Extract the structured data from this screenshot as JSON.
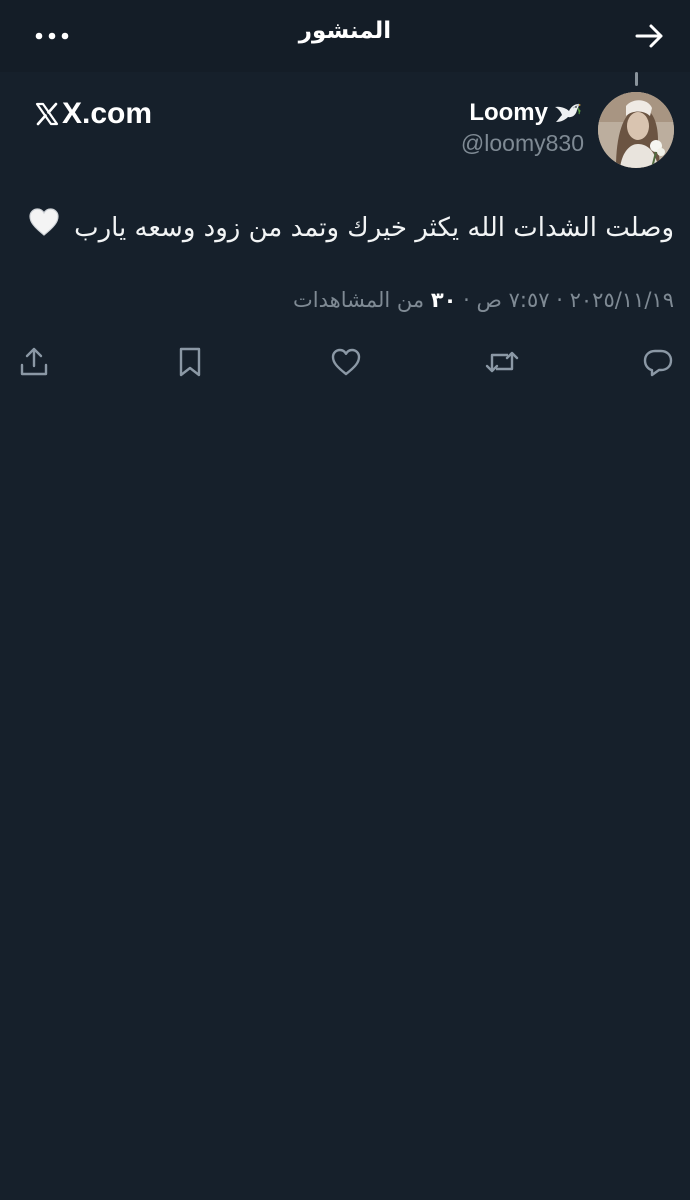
{
  "header": {
    "title": "المنشور",
    "back_icon": "arrow-right-icon",
    "more_icon": "more-horizontal-icon"
  },
  "author": {
    "display_name": "Loomy",
    "name_emoji": "dove-icon",
    "handle": "@loomy830"
  },
  "source": {
    "domain": "X.com"
  },
  "post": {
    "text": "وصلت الشدات الله يكثر خيرك وتمد من زود وسعه يارب",
    "trailing_emoji": "white-heart-icon"
  },
  "meta": {
    "date": "٢٠٢٥/١١/١٩",
    "separator": "·",
    "time": "٧:٥٧ ص",
    "views_count": "٣٠",
    "views_label": "من المشاهدات"
  },
  "actions": {
    "reply_icon": "reply-icon",
    "repost_icon": "repost-icon",
    "like_icon": "heart-icon",
    "bookmark_icon": "bookmark-icon",
    "share_icon": "share-icon"
  },
  "colors": {
    "background": "#16202b",
    "header_background": "#141d27",
    "primary_text": "#ffffff",
    "secondary_text": "#7f8a94",
    "icon": "#8b98a5"
  }
}
